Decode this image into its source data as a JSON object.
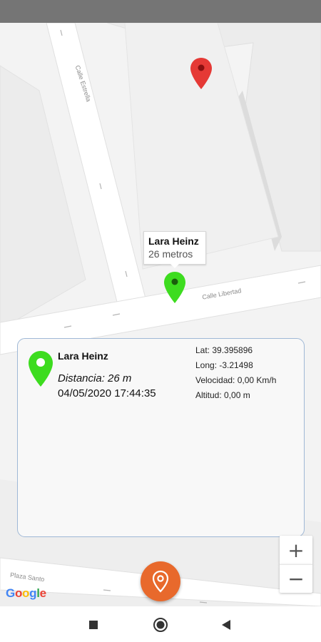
{
  "map": {
    "streets": {
      "calle_estrella": "Calle Estrella",
      "calle_libertad": "Calle Libertad",
      "plaza_santo": "Plaza Santo"
    },
    "info_window": {
      "title": "Lara Heinz",
      "subtitle": "26 metros"
    },
    "markers": [
      {
        "name": "destination",
        "color": "#e53935"
      },
      {
        "name": "user",
        "color": "#3ddc1f"
      }
    ],
    "attribution": [
      "G",
      "o",
      "o",
      "g",
      "l",
      "e"
    ],
    "attribution_colors": [
      "#4285F4",
      "#EA4335",
      "#FBBC05",
      "#4285F4",
      "#34A853",
      "#EA4335"
    ],
    "zoom": {
      "in_label": "+",
      "out_label": "−"
    }
  },
  "card": {
    "name": "Lara Heinz",
    "distance": "Distancia: 26 m",
    "datetime": "04/05/2020 17:44:35",
    "lat": "Lat:  39.395896",
    "long": "Long: -3.21498",
    "velocidad": "Velocidad: 0,00 Km/h",
    "altitud": "Altitud: 0,00 m",
    "pin_color": "#3ddc1f",
    "border_color": "#9fb8d6"
  },
  "fab": {
    "icon": "location-pin-icon",
    "color": "#e8692c"
  },
  "nav": {
    "buttons": [
      "recents-square-icon",
      "home-circle-icon",
      "back-triangle-icon"
    ]
  }
}
